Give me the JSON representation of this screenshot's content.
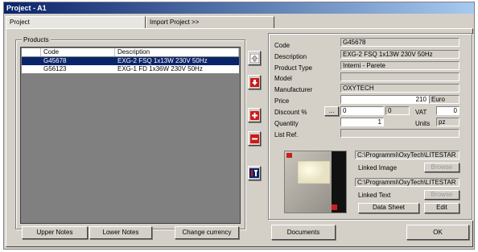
{
  "window": {
    "title": "Project - A1"
  },
  "tabs": [
    {
      "label": "Project"
    },
    {
      "label": "Import Project >>"
    }
  ],
  "products": {
    "group_label": "Products",
    "columns": [
      "Code",
      "Description"
    ],
    "rows": [
      {
        "code": "G45678",
        "description": "EXG-2 FSQ 1x13W 230V 50Hz",
        "selected": true
      },
      {
        "code": "G56123",
        "description": "EXG-1 FD 1x36W 230V 50Hz",
        "selected": false
      }
    ]
  },
  "side_buttons": {
    "up_icon": "arrow-up-icon",
    "down_icon": "arrow-down-icon",
    "add_icon": "plus-icon",
    "remove_icon": "minus-icon",
    "tools_icon": "tools-icon"
  },
  "details": {
    "code_label": "Code",
    "code": "G45678",
    "description_label": "Description",
    "description": "EXG-2 FSQ 1x13W 230V 50Hz",
    "product_type_label": "Product Type",
    "product_type": "Interni - Parete",
    "model_label": "Model",
    "model": "",
    "manufacturer_label": "Manufacturer",
    "manufacturer": "OXYTECH",
    "price_label": "Price",
    "price": "210",
    "currency": "Euro",
    "discount_label": "Discount %",
    "discount_button": "...",
    "discount_value": "0",
    "discount_extra": "0",
    "vat_label": "VAT",
    "vat": "0",
    "quantity_label": "Quantity",
    "quantity": "1",
    "units_label": "Units",
    "units": "pz",
    "list_ref_label": "List Ref.",
    "list_ref": ""
  },
  "linked": {
    "image_path": "C:\\Programmi\\OxyTech\\LITESTAR",
    "image_label": "Linked Image",
    "image_browse": "Browse",
    "text_path": "C:\\Programmi\\OxyTech\\LITESTAR",
    "text_label": "Linked Text",
    "text_browse": "Browse",
    "data_sheet": "Data Sheet",
    "edit": "Edit"
  },
  "bottom_buttons": {
    "upper_notes": "Upper Notes",
    "lower_notes": "Lower Notes",
    "change_currency": "Change currency",
    "documents": "Documents",
    "ok": "OK"
  },
  "colors": {
    "selection": "#0a246a",
    "arrow_red": "#d01818",
    "face": "#d4d0c8"
  }
}
